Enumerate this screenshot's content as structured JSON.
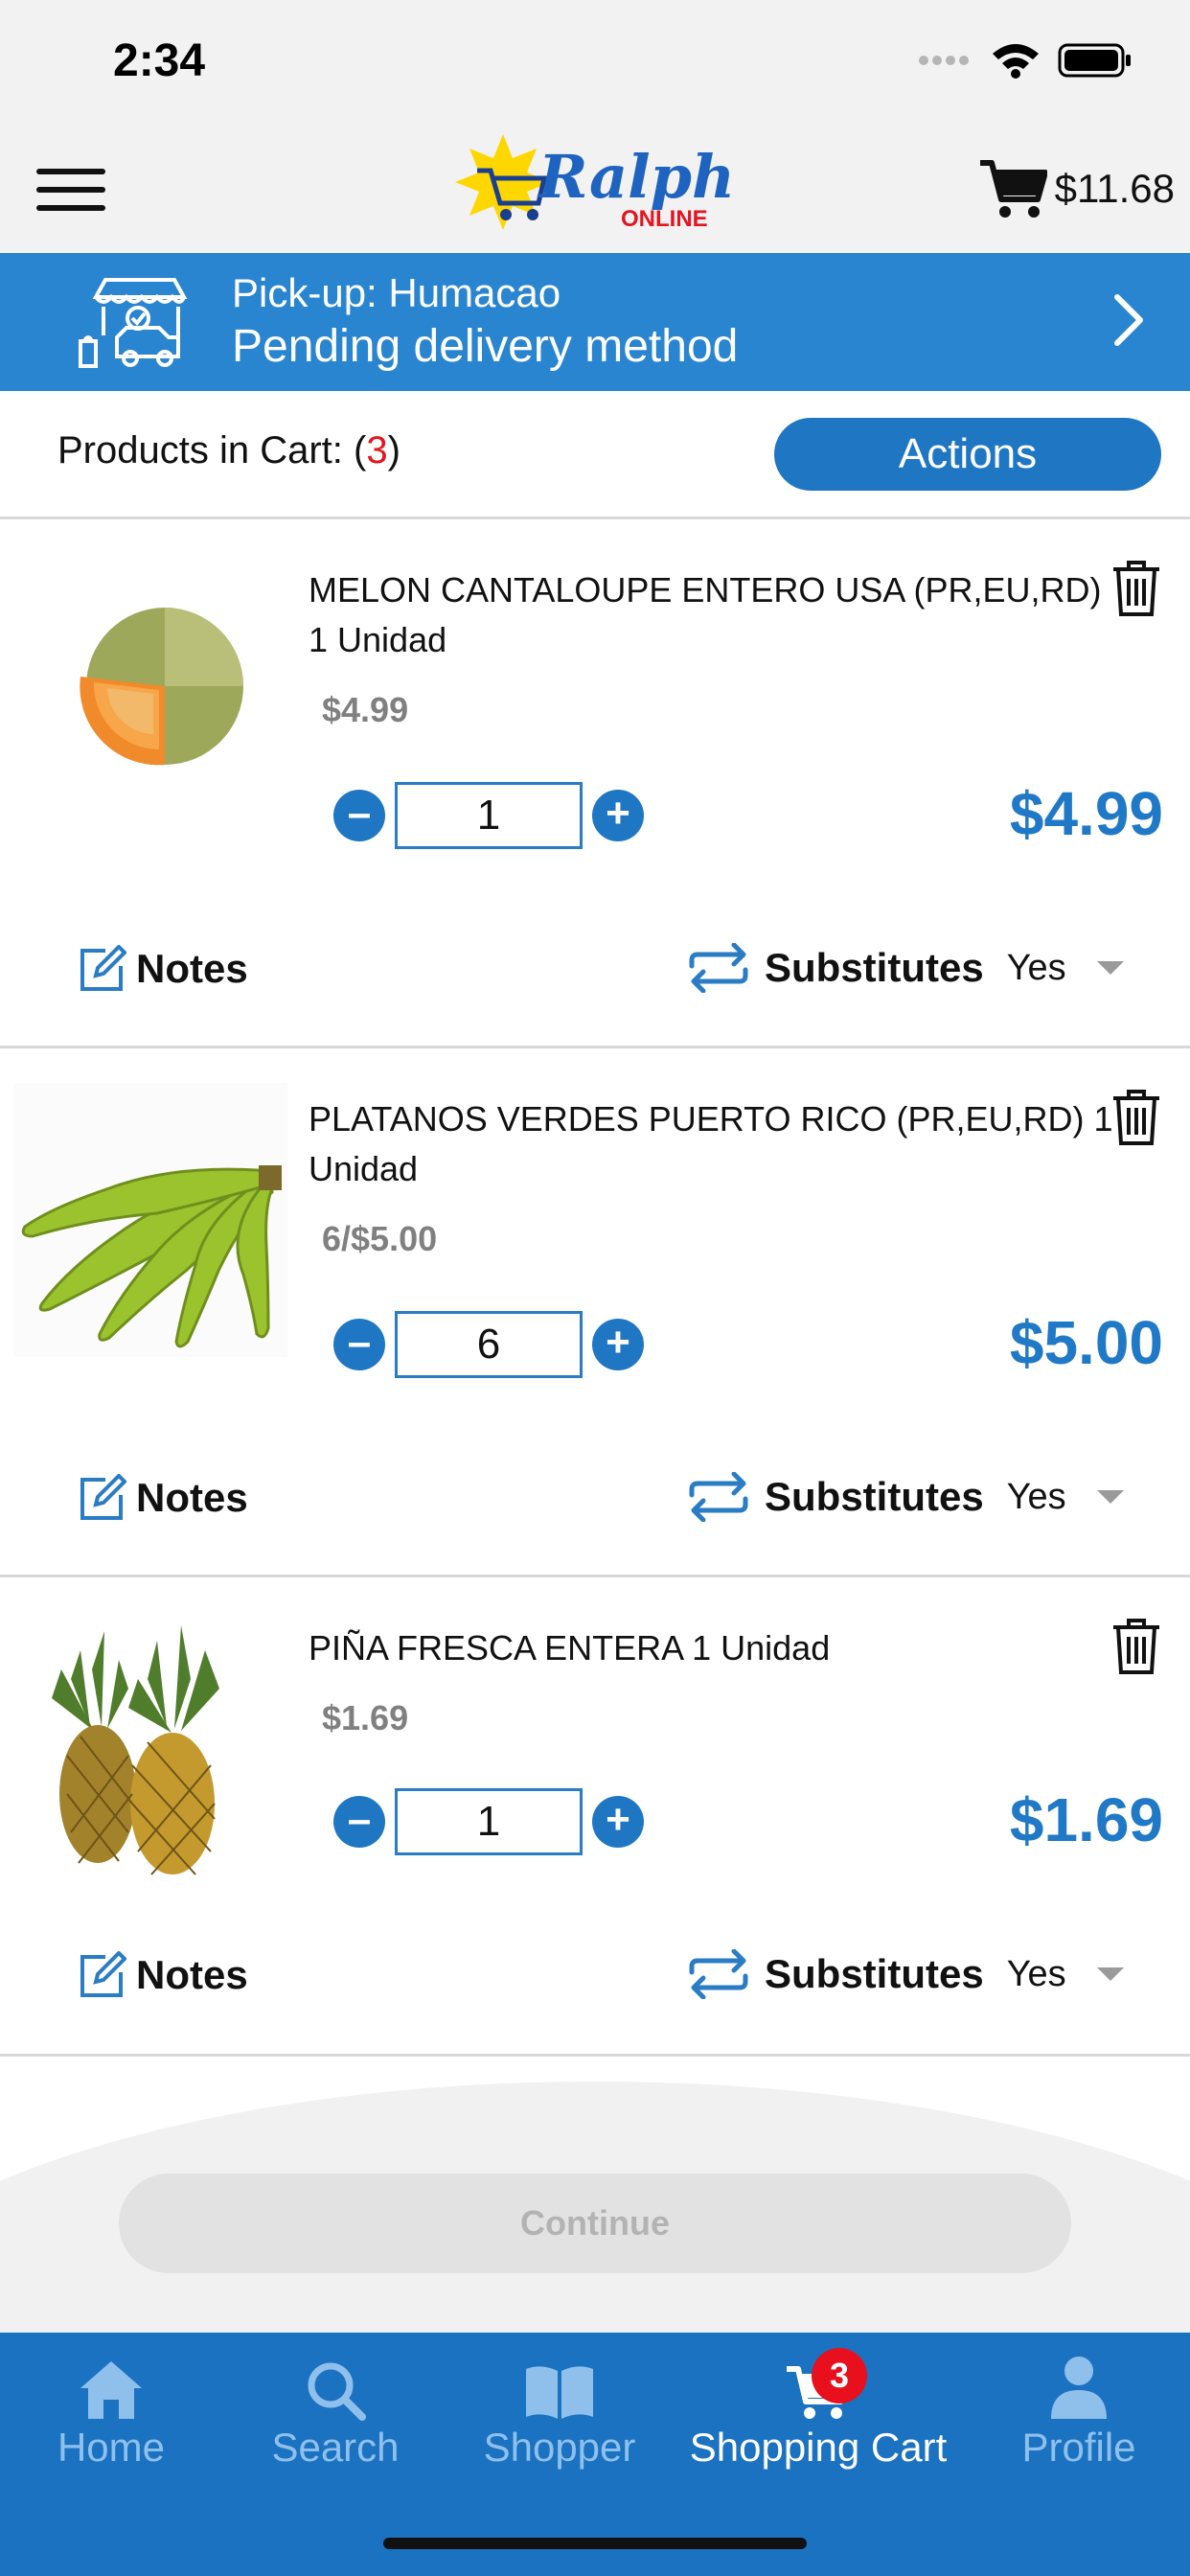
{
  "status_bar": {
    "time": "2:34"
  },
  "header": {
    "logo_alt": "Ralph's Online",
    "logo_word": "Ralph's",
    "logo_sub": "ONLINE",
    "cart_total": "$11.68"
  },
  "delivery": {
    "line1": "Pick-up: Humacao",
    "line2": "Pending delivery method"
  },
  "cart_bar": {
    "label_prefix": "Products in Cart: (",
    "count": "3",
    "label_suffix": ")",
    "actions_label": "Actions"
  },
  "items": [
    {
      "name": "MELON CANTALOUPE ENTERO USA (PR,EU,RD) 1 Unidad",
      "unit_price": "$4.99",
      "quantity": "1",
      "line_total": "$4.99",
      "notes_label": "Notes",
      "substitutes_label": "Substitutes",
      "substitutes_value": "Yes"
    },
    {
      "name": "PLATANOS VERDES PUERTO RICO (PR,EU,RD) 1 Unidad",
      "unit_price": "6/$5.00",
      "quantity": "6",
      "line_total": "$5.00",
      "notes_label": "Notes",
      "substitutes_label": "Substitutes",
      "substitutes_value": "Yes"
    },
    {
      "name": "PIÑA FRESCA ENTERA 1 Unidad",
      "unit_price": "$1.69",
      "quantity": "1",
      "line_total": "$1.69",
      "notes_label": "Notes",
      "substitutes_label": "Substitutes",
      "substitutes_value": "Yes"
    }
  ],
  "footer": {
    "continue_label": "Continue"
  },
  "tabs": [
    {
      "label": "Home",
      "icon": "home-icon"
    },
    {
      "label": "Search",
      "icon": "search-icon"
    },
    {
      "label": "Shopper",
      "icon": "book-icon"
    },
    {
      "label": "Shopping Cart",
      "icon": "cart-icon",
      "badge": "3",
      "active": true
    },
    {
      "label": "Profile",
      "icon": "person-icon"
    }
  ],
  "colors": {
    "brand_blue": "#1f77c4",
    "banner_blue": "#2a85d0",
    "price_blue": "#2079c7",
    "badge_red": "#e8101d"
  }
}
